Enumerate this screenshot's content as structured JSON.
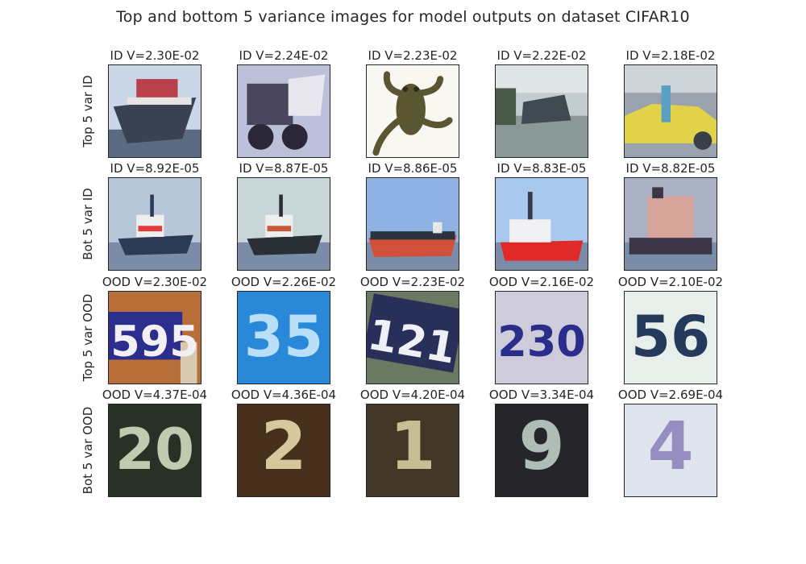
{
  "figure": {
    "title": "Top and bottom 5 variance images for model outputs on dataset CIFAR10"
  },
  "rows": [
    {
      "label": "Top 5 var ID",
      "cells": [
        {
          "title": "ID V=2.30E-02",
          "image": "ship-red-deck",
          "bg": "#c9d7e6",
          "fg": "#3a4252",
          "accent": "#b8404a"
        },
        {
          "title": "ID V=2.24E-02",
          "image": "dump-truck",
          "bg": "#bcc0d8",
          "fg": "#4b4660",
          "accent": "#e8e6ef"
        },
        {
          "title": "ID V=2.23E-02",
          "image": "frog",
          "bg": "#f8f7f2",
          "fg": "#5b5632",
          "accent": "#2f2d1c"
        },
        {
          "title": "ID V=2.22E-02",
          "image": "boat-on-water",
          "bg": "#c3ccce",
          "fg": "#3f4950",
          "accent": "#8a9a98"
        },
        {
          "title": "ID V=2.18E-02",
          "image": "yellow-car",
          "bg": "#9aa2ad",
          "fg": "#e2d24a",
          "accent": "#3a3e48"
        }
      ]
    },
    {
      "label": "Bot 5 var ID",
      "cells": [
        {
          "title": "ID V=8.92E-05",
          "image": "tugboat",
          "bg": "#b8c6d9",
          "fg": "#2c3a55",
          "accent": "#e23b3b"
        },
        {
          "title": "ID V=8.87E-05",
          "image": "ship-dark-hull",
          "bg": "#c9d6d8",
          "fg": "#2a2f36",
          "accent": "#c65a3c"
        },
        {
          "title": "ID V=8.86E-05",
          "image": "cargo-ship",
          "bg": "#8fb1e4",
          "fg": "#2b3240",
          "accent": "#d0503b"
        },
        {
          "title": "ID V=8.83E-05",
          "image": "red-ship",
          "bg": "#a9c8ee",
          "fg": "#e02a2a",
          "accent": "#f1f1f4"
        },
        {
          "title": "ID V=8.82E-05",
          "image": "pink-ship",
          "bg": "#a9b1c2",
          "fg": "#d7a49a",
          "accent": "#3b3546"
        }
      ]
    },
    {
      "label": "Top 5 var OOD",
      "cells": [
        {
          "title": "OOD V=2.30E-02",
          "image": "digits-595",
          "digits": "595",
          "bg": "#b86e38",
          "fg": "#f3f0f5",
          "accent": "#2b2e8c"
        },
        {
          "title": "OOD V=2.26E-02",
          "image": "digits-35",
          "digits": "35",
          "bg": "#2a88d8",
          "fg": "#b9e0f8",
          "accent": "#1f6fbe"
        },
        {
          "title": "OOD V=2.23E-02",
          "image": "digits-121",
          "digits": "121",
          "bg": "#6a7a62",
          "fg": "#eef0f5",
          "accent": "#28305a"
        },
        {
          "title": "OOD V=2.16E-02",
          "image": "digits-230",
          "digits": "230",
          "bg": "#d8d6e2",
          "fg": "#2b2d8a",
          "accent": "#c0bfd0"
        },
        {
          "title": "OOD V=2.10E-02",
          "image": "digits-56",
          "digits": "56",
          "bg": "#eff3ee",
          "fg": "#243a5a",
          "accent": "#dfe5e0"
        }
      ]
    },
    {
      "label": "Bot 5 var OOD",
      "cells": [
        {
          "title": "OOD V=4.37E-04",
          "image": "digits-20",
          "digits": "20",
          "bg": "#202820",
          "fg": "#d8e6c8",
          "accent": "#3a4a38"
        },
        {
          "title": "OOD V=4.36E-04",
          "image": "digits-2",
          "digits": "2",
          "bg": "#3a2616",
          "fg": "#f0e2b4",
          "accent": "#6a4a2a"
        },
        {
          "title": "OOD V=4.20E-04",
          "image": "digits-1",
          "digits": "1",
          "bg": "#3a3022",
          "fg": "#e0d6a8",
          "accent": "#5a4a34"
        },
        {
          "title": "OOD V=3.34E-04",
          "image": "digits-9",
          "digits": "9",
          "bg": "#1e1e22",
          "fg": "#c8d8d0",
          "accent": "#3c3c44"
        },
        {
          "title": "OOD V=2.69E-04",
          "image": "digits-4",
          "digits": "4",
          "bg": "#e4e8f2",
          "fg": "#8a80b8",
          "accent": "#cfd6e6"
        }
      ]
    }
  ]
}
